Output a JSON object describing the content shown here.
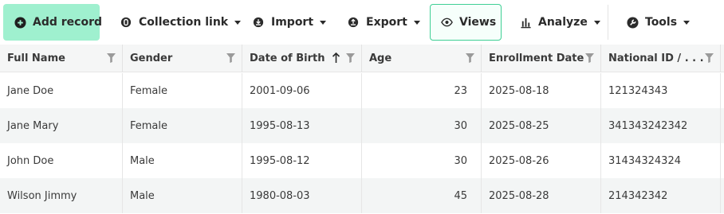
{
  "toolbar": {
    "add_record": "Add record",
    "collection_link": "Collection link",
    "import": "Import",
    "export": "Export",
    "views": "Views",
    "analyze": "Analyze",
    "tools": "Tools"
  },
  "table": {
    "columns": [
      {
        "label": "Full Name"
      },
      {
        "label": "Gender"
      },
      {
        "label": "Date of Birth",
        "sort": "ascending"
      },
      {
        "label": "Age"
      },
      {
        "label": "Enrollment Date"
      },
      {
        "label": "National ID / . . ."
      }
    ],
    "rows": [
      [
        "Jane Doe",
        "Female",
        "2001-09-06",
        "23",
        "2025-08-18",
        "121324343"
      ],
      [
        "Jane Mary",
        "Female",
        "1995-08-13",
        "30",
        "2025-08-25",
        "341343242342"
      ],
      [
        "John Doe",
        "Male",
        "1995-08-12",
        "30",
        "2025-08-26",
        "31434324324"
      ],
      [
        "Wilson Jimmy",
        "Male",
        "1980-08-03",
        "45",
        "2025-08-28",
        "214342342"
      ]
    ]
  },
  "colors": {
    "accent": "#9ff0cf",
    "accent_border": "#3fcf95",
    "header_bg": "#f5f6f6",
    "alt_row_bg": "#f3f5f5"
  }
}
